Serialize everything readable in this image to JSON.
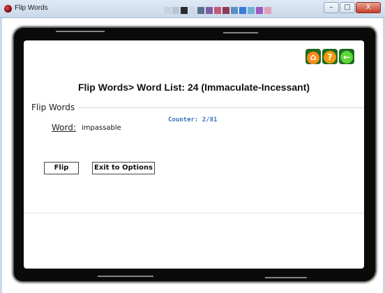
{
  "window": {
    "title": "Flip Words",
    "minimize_glyph": "–",
    "maximize_glyph": "□",
    "close_glyph": "X"
  },
  "taskbar_thumbnails": [
    "#c8d2df",
    "#b9c6d6",
    "#2a2a2a",
    "#cfd8e3",
    "#5a6e8e",
    "#7e5e9e",
    "#c25a7a",
    "#8e3a56",
    "#5a8ec2",
    "#3a7ad8",
    "#6eb2d8",
    "#9e5ac2",
    "#e0a0b8"
  ],
  "toolbar": {
    "home_icon": "home-icon",
    "help_icon": "help-icon",
    "back_icon": "back-arrow-icon",
    "home_glyph": "⌂",
    "help_glyph": "?",
    "back_glyph": "←"
  },
  "heading": "Flip Words> Word List: 24 (Immaculate-Incessant)",
  "section": {
    "label": "Flip Words"
  },
  "counter": "Counter: 2/81",
  "word": {
    "label": "Word:",
    "value": "impassable"
  },
  "buttons": {
    "flip": "Flip",
    "exit": "Exit to Options"
  },
  "colors": {
    "frame": "#0a0a0a",
    "counter": "#3b73b9",
    "icon_bg": "#1f6b1f"
  }
}
